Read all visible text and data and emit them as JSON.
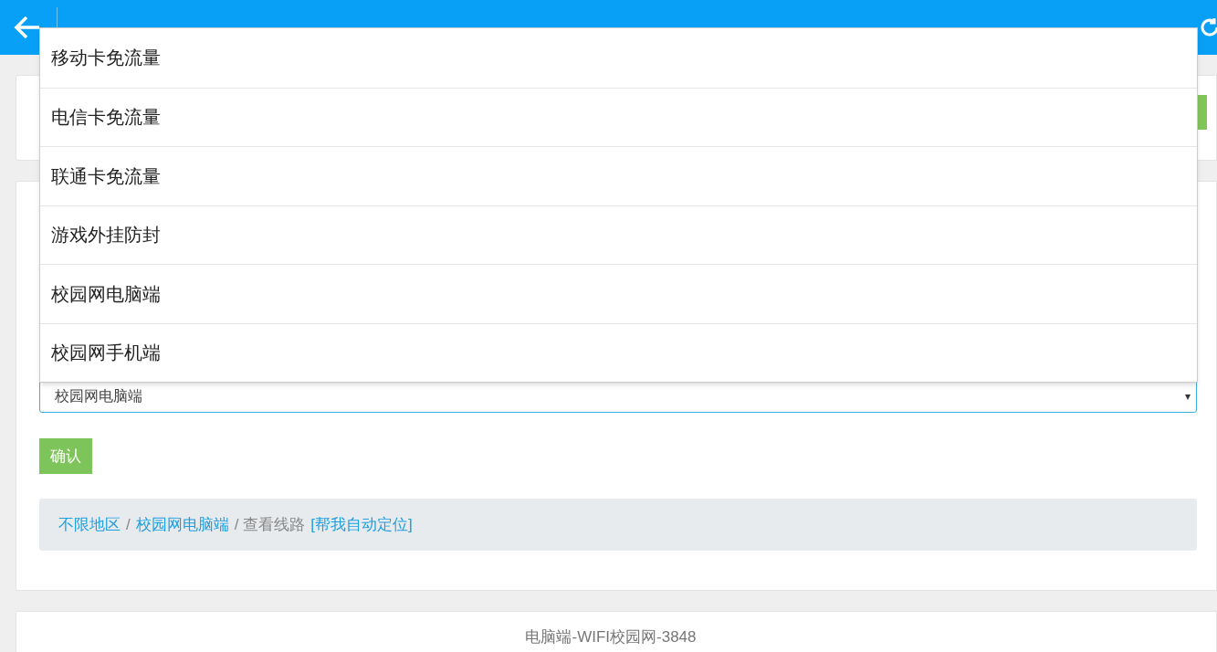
{
  "dropdown": {
    "options": [
      {
        "label": "移动卡免流量"
      },
      {
        "label": "电信卡免流量"
      },
      {
        "label": "联通卡免流量"
      },
      {
        "label": "游戏外挂防封"
      },
      {
        "label": "校园网电脑端"
      },
      {
        "label": "校园网手机端"
      }
    ],
    "value": "校园网电脑端",
    "caret": "▾"
  },
  "confirm_button": "确认",
  "breadcrumb": [
    {
      "kind": "link",
      "text": "不限地区"
    },
    {
      "kind": "text",
      "text": "/"
    },
    {
      "kind": "link",
      "text": "校园网电脑端"
    },
    {
      "kind": "text",
      "text": "/ 查看线路"
    },
    {
      "kind": "link",
      "text": "[帮我自动定位]"
    }
  ],
  "footer_card": {
    "title": "电脑端-WIFI校园网-3848"
  }
}
